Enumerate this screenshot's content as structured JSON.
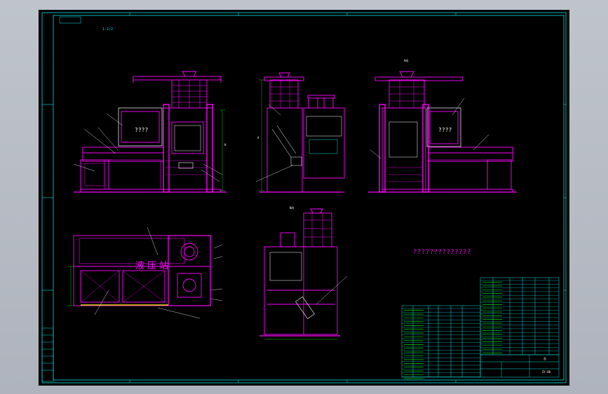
{
  "drawing": {
    "zoom_label": "1:2/2",
    "note_text": "??????????????",
    "station_label": "液压站",
    "front_panel_label": "????",
    "right_panel_label": "????",
    "section_label_a": "A向",
    "section_label_b": "B向",
    "dimension_h": "H",
    "dimension_a": "A",
    "title_block_name": "总",
    "title_block_code": "ZY-00"
  },
  "colors": {
    "frame": "#00e0e0",
    "geometry": "#ff00ff",
    "dimension": "#00ff00",
    "text": "#ffffff",
    "table_text": "#00ff00",
    "highlight": "#ffff00"
  }
}
